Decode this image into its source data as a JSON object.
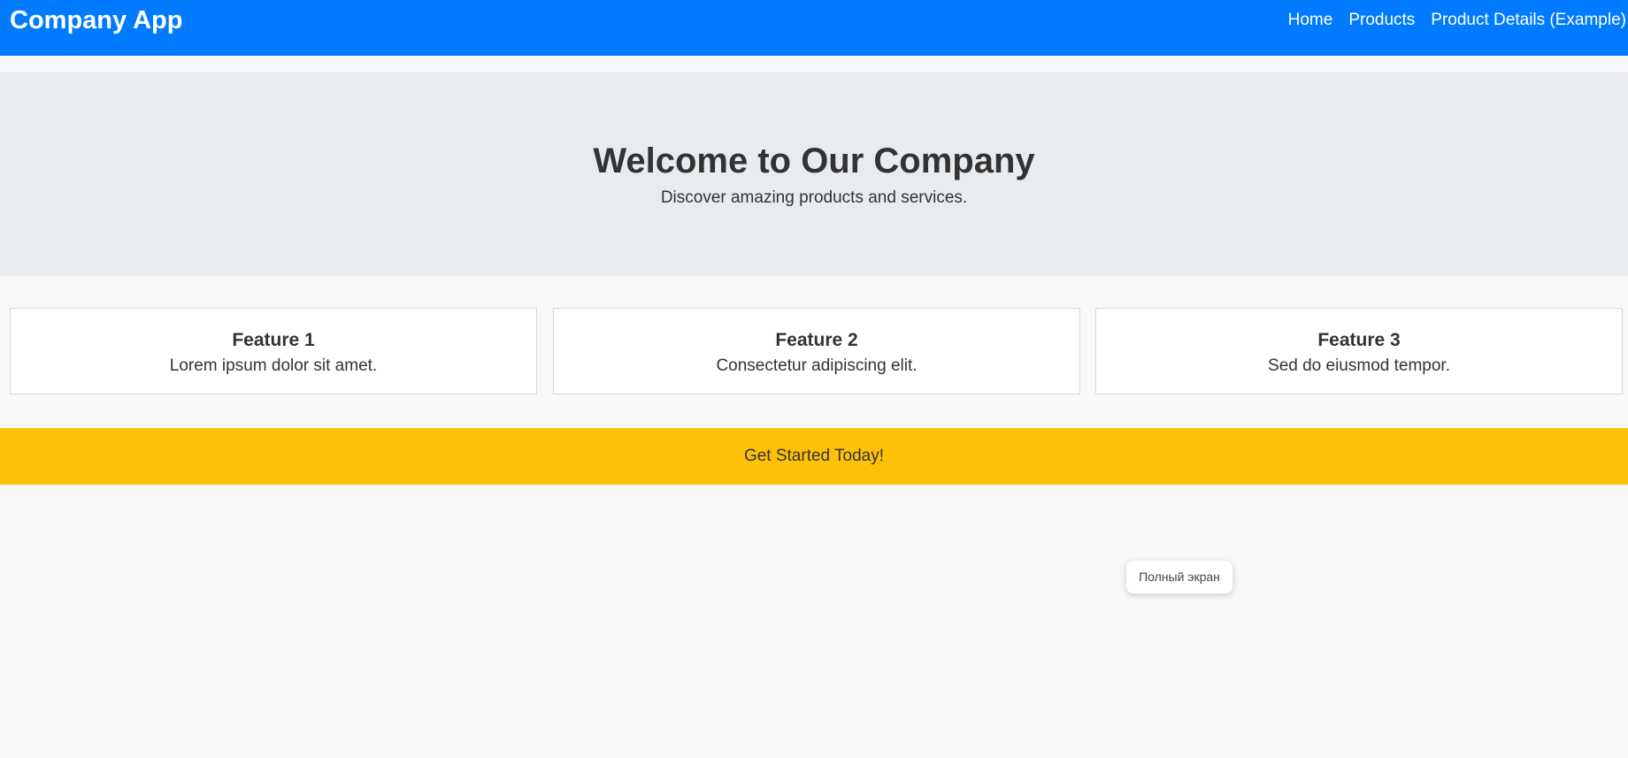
{
  "header": {
    "brand": "Company App",
    "nav": [
      "Home",
      "Products",
      "Product Details (Example)"
    ]
  },
  "hero": {
    "title": "Welcome to Our Company",
    "subtitle": "Discover amazing products and services."
  },
  "features": [
    {
      "title": "Feature 1",
      "text": "Lorem ipsum dolor sit amet."
    },
    {
      "title": "Feature 2",
      "text": "Consectetur adipiscing elit."
    },
    {
      "title": "Feature 3",
      "text": "Sed do eiusmod tempor."
    }
  ],
  "cta": {
    "label": "Get Started Today!"
  },
  "overlay": {
    "fullscreen_label": "Полный экран"
  },
  "colors": {
    "header_bg": "#007bff",
    "hero_bg": "#e8ecef",
    "cta_bg": "#ffc107",
    "page_bg": "#f8f8f8"
  }
}
